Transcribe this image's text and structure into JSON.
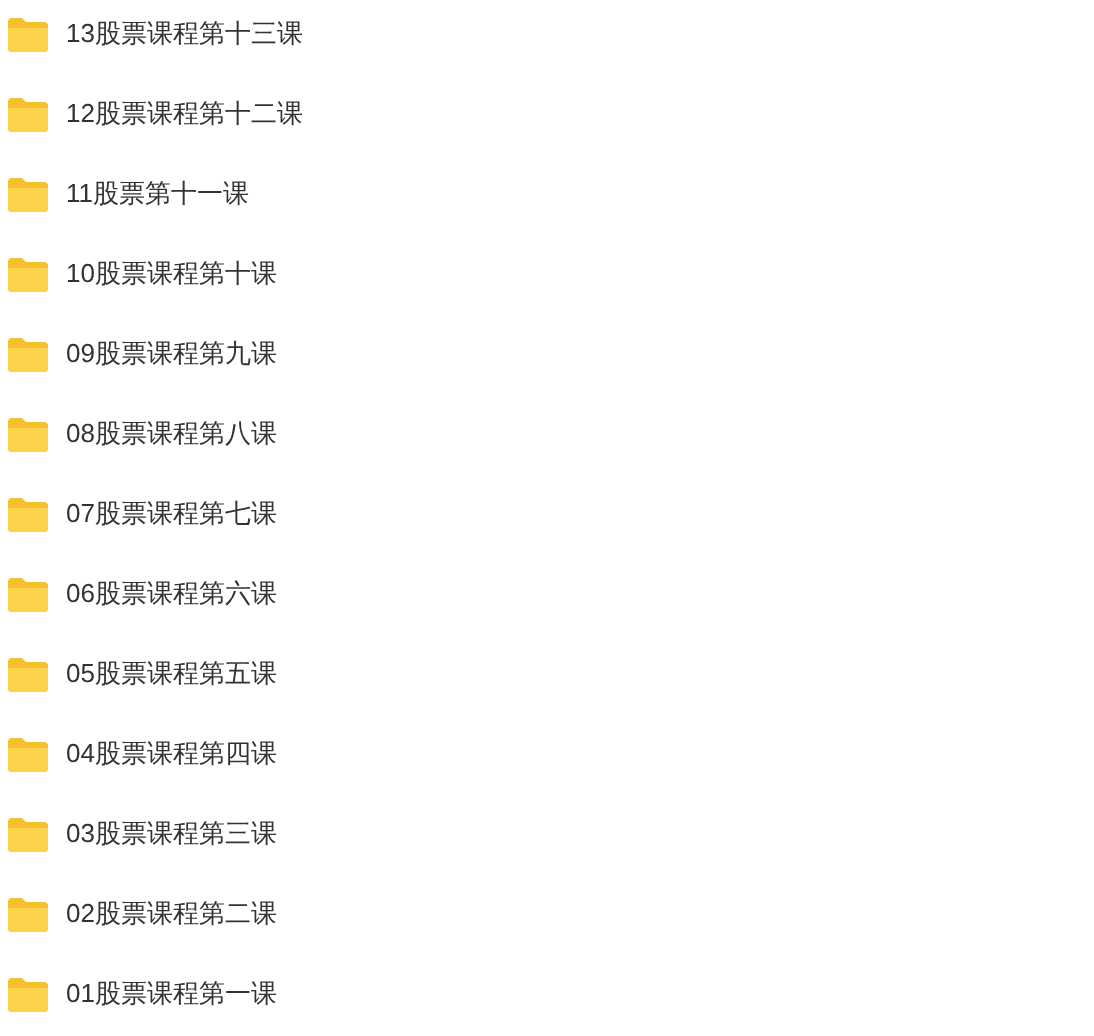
{
  "folders": [
    {
      "name": "13股票课程第十三课"
    },
    {
      "name": "12股票课程第十二课"
    },
    {
      "name": "11股票第十一课"
    },
    {
      "name": "10股票课程第十课"
    },
    {
      "name": "09股票课程第九课"
    },
    {
      "name": "08股票课程第八课"
    },
    {
      "name": "07股票课程第七课"
    },
    {
      "name": "06股票课程第六课"
    },
    {
      "name": "05股票课程第五课"
    },
    {
      "name": "04股票课程第四课"
    },
    {
      "name": "03股票课程第三课"
    },
    {
      "name": "02股票课程第二课"
    },
    {
      "name": "01股票课程第一课"
    }
  ]
}
